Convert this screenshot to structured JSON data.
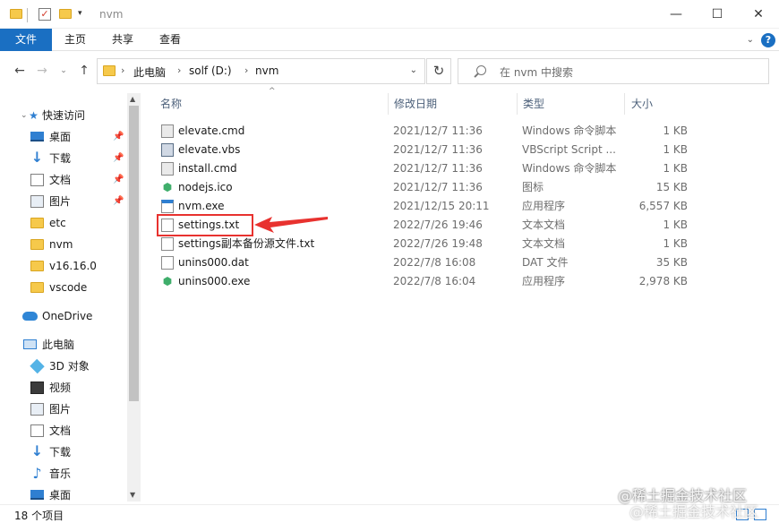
{
  "window": {
    "title": "nvm",
    "minimize_glyph": "—",
    "maximize_glyph": "☐",
    "close_glyph": "✕"
  },
  "ribbon": {
    "tabs": [
      "文件",
      "主页",
      "共享",
      "查看"
    ],
    "help_glyph": "?"
  },
  "address": {
    "crumbs": [
      "此电脑",
      "solf (D:)",
      "nvm"
    ]
  },
  "search": {
    "placeholder": "在 nvm 中搜索"
  },
  "sidebar": {
    "quick_access": "快速访问",
    "items": [
      {
        "label": "桌面",
        "icon": "desktop-icon",
        "pinned": true
      },
      {
        "label": "下载",
        "icon": "download-icon",
        "pinned": true
      },
      {
        "label": "文档",
        "icon": "document-icon",
        "pinned": true
      },
      {
        "label": "图片",
        "icon": "pictures-icon",
        "pinned": true
      },
      {
        "label": "etc",
        "icon": "folder-icon",
        "pinned": false
      },
      {
        "label": "nvm",
        "icon": "folder-icon",
        "pinned": false
      },
      {
        "label": "v16.16.0",
        "icon": "folder-icon",
        "pinned": false
      },
      {
        "label": "vscode",
        "icon": "folder-icon",
        "pinned": false
      }
    ],
    "onedrive": "OneDrive",
    "this_pc": "此电脑",
    "pc_items": [
      {
        "label": "3D 对象",
        "icon": "3d-objects-icon"
      },
      {
        "label": "视频",
        "icon": "video-icon"
      },
      {
        "label": "图片",
        "icon": "pictures-icon"
      },
      {
        "label": "文档",
        "icon": "document-icon"
      },
      {
        "label": "下载",
        "icon": "download-icon"
      },
      {
        "label": "音乐",
        "icon": "music-icon"
      },
      {
        "label": "桌面",
        "icon": "desktop-icon"
      }
    ]
  },
  "columns": {
    "name": "名称",
    "date": "修改日期",
    "type": "类型",
    "size": "大小"
  },
  "files": [
    {
      "name": "elevate.cmd",
      "date": "2021/12/7 11:36",
      "type": "Windows 命令脚本",
      "size": "1 KB",
      "icon": "cmd-file-icon"
    },
    {
      "name": "elevate.vbs",
      "date": "2021/12/7 11:36",
      "type": "VBScript Script ...",
      "size": "1 KB",
      "icon": "vbs-file-icon"
    },
    {
      "name": "install.cmd",
      "date": "2021/12/7 11:36",
      "type": "Windows 命令脚本",
      "size": "1 KB",
      "icon": "cmd-file-icon"
    },
    {
      "name": "nodejs.ico",
      "date": "2021/12/7 11:36",
      "type": "图标",
      "size": "15 KB",
      "icon": "nodejs-icon"
    },
    {
      "name": "nvm.exe",
      "date": "2021/12/15 20:11",
      "type": "应用程序",
      "size": "6,557 KB",
      "icon": "exe-file-icon"
    },
    {
      "name": "settings.txt",
      "date": "2022/7/26 19:46",
      "type": "文本文档",
      "size": "1 KB",
      "icon": "txt-file-icon"
    },
    {
      "name": "settings副本备份源文件.txt",
      "date": "2022/7/26 19:48",
      "type": "文本文档",
      "size": "1 KB",
      "icon": "txt-file-icon"
    },
    {
      "name": "unins000.dat",
      "date": "2022/7/8 16:08",
      "type": "DAT 文件",
      "size": "35 KB",
      "icon": "dat-file-icon"
    },
    {
      "name": "unins000.exe",
      "date": "2022/7/8 16:04",
      "type": "应用程序",
      "size": "2,978 KB",
      "icon": "installer-icon"
    }
  ],
  "status": {
    "item_count": "18 个项目"
  },
  "watermark": "@稀土掘金技术社区",
  "colors": {
    "accent": "#1a6fc2",
    "highlight": "#e8322f"
  }
}
